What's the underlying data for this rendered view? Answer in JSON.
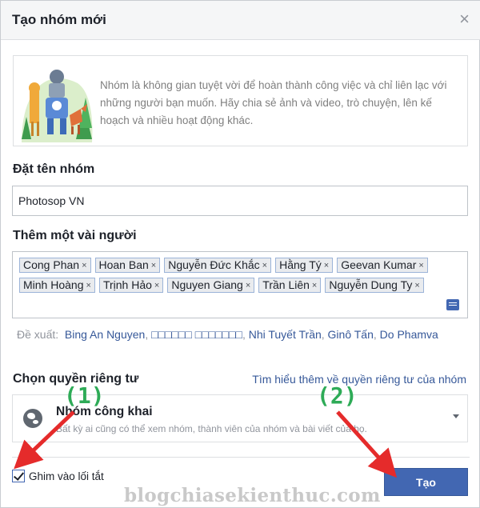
{
  "dialog": {
    "title": "Tạo nhóm mới",
    "close_label": "×",
    "intro_text": "Nhóm là không gian tuyệt vời để hoàn thành công việc và chỉ liên lạc với những người bạn muốn. Hãy chia sẻ ảnh và video, trò chuyện, lên kế hoạch và nhiều hoạt động khác."
  },
  "group_name": {
    "label": "Đặt tên nhóm",
    "value": "Photosop VN"
  },
  "members": {
    "label": "Thêm một vài người",
    "tags": [
      {
        "name": "Cong Phan"
      },
      {
        "name": "Hoan Ban"
      },
      {
        "name": "Nguyễn Đức Khắc"
      },
      {
        "name": "Hằng Tý"
      },
      {
        "name": "Geevan Kumar"
      },
      {
        "name": "Minh Hoàng"
      },
      {
        "name": "Trịnh Hảo"
      },
      {
        "name": "Nguyen Giang"
      },
      {
        "name": "Trần Liên"
      },
      {
        "name": "Nguyễn Dung Ty"
      }
    ],
    "remove_glyph": "×"
  },
  "suggestions": {
    "prefix": "Đề xuất:",
    "items": [
      "Bing An Nguyen",
      "□□□□□□ □□□□□□□",
      "Nhi Tuyết Trần",
      "Ginô Tấn",
      "Do Phamva"
    ]
  },
  "privacy": {
    "label": "Chọn quyền riêng tư",
    "learn_more": "Tìm hiểu thêm về quyền riêng tư của nhóm",
    "selected_title": "Nhóm công khai",
    "selected_desc": "Bất kỳ ai cũng có thể xem nhóm, thành viên của nhóm và bài viết của họ."
  },
  "footer": {
    "pin_label": "Ghim vào lối tắt",
    "pin_checked": true,
    "create_label": "Tạo"
  },
  "annotations": {
    "step1": "(1)",
    "step2": "(2)",
    "arrow_color": "#e52b2b",
    "step_color": "#2eab57"
  },
  "watermark": "blogchiasekienthuc.com",
  "colors": {
    "primary": "#4267b2",
    "link": "#365899",
    "muted": "#90949c"
  }
}
